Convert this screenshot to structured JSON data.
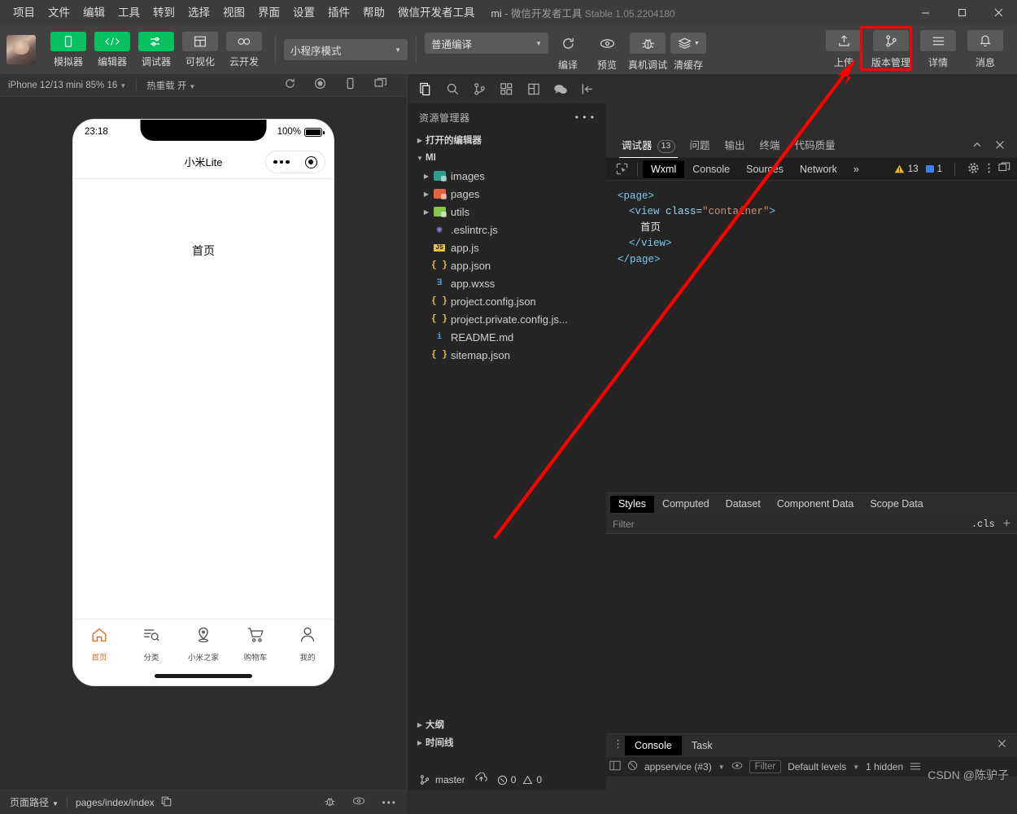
{
  "window": {
    "menus": [
      "项目",
      "文件",
      "编辑",
      "工具",
      "转到",
      "选择",
      "视图",
      "界面",
      "设置",
      "插件",
      "帮助",
      "微信开发者工具"
    ],
    "project_name": "mi",
    "dash": "-",
    "app_name": "微信开发者工具",
    "version": "Stable 1.05.2204180",
    "minimize": "−",
    "maximize": "□",
    "close": "✕"
  },
  "toolbar": {
    "left_buttons": [
      {
        "label": "模拟器",
        "icon": "phone-icon",
        "style": "green"
      },
      {
        "label": "编辑器",
        "icon": "code-icon",
        "style": "green"
      },
      {
        "label": "调试器",
        "icon": "sliders-icon",
        "style": "green"
      },
      {
        "label": "可视化",
        "icon": "layout-icon",
        "style": "grey"
      },
      {
        "label": "云开发",
        "icon": "cloud-icon",
        "style": "grey"
      }
    ],
    "mode_select": "小程序模式",
    "compile_select": "普通编译",
    "action_buttons": [
      {
        "label": "编译",
        "icon": "refresh-icon"
      },
      {
        "label": "预览",
        "icon": "eye-icon"
      },
      {
        "label": "真机调试",
        "icon": "bug-icon"
      },
      {
        "label": "清缓存",
        "icon": "layers-icon"
      }
    ],
    "right_buttons": [
      {
        "label": "上传",
        "icon": "upload-icon"
      },
      {
        "label": "版本管理",
        "icon": "git-branch-icon"
      },
      {
        "label": "详情",
        "icon": "menu-icon"
      },
      {
        "label": "消息",
        "icon": "bell-icon"
      }
    ],
    "highlighted_button": "版本管理"
  },
  "simulator": {
    "device": "iPhone 12/13 mini 85% 16",
    "hot_reload": "热重载 开",
    "icons": [
      "refresh-icon",
      "record-icon",
      "rotate-icon",
      "multi-window-icon"
    ],
    "phone": {
      "time": "23:18",
      "battery": "100%",
      "nav_title": "小米Lite",
      "page_text": "首页",
      "tabs": [
        {
          "label": "首页",
          "icon": "home-icon",
          "active": true
        },
        {
          "label": "分类",
          "icon": "category-icon",
          "active": false
        },
        {
          "label": "小米之家",
          "icon": "location-icon",
          "active": false
        },
        {
          "label": "购物车",
          "icon": "cart-icon",
          "active": false
        },
        {
          "label": "我的",
          "icon": "person-icon",
          "active": false
        }
      ]
    }
  },
  "explorer": {
    "activity_icons": [
      "files-icon",
      "search-icon",
      "source-control-icon",
      "extensions-icon",
      "snippets-icon",
      "wechat-icon",
      "collapse-icon"
    ],
    "title": "资源管理器",
    "more": "• • •",
    "sections": [
      {
        "label": "打开的编辑器",
        "expanded": false
      },
      {
        "label": "MI",
        "expanded": true
      }
    ],
    "files": [
      {
        "name": "images",
        "type": "folder",
        "color": "#2e9e8f"
      },
      {
        "name": "pages",
        "type": "folder",
        "color": "#e8603c"
      },
      {
        "name": "utils",
        "type": "folder",
        "color": "#8bc34a"
      },
      {
        "name": ".eslintrc.js",
        "type": "file",
        "icon": "eslint-icon",
        "glyph": "◉",
        "color": "#8a7fd1"
      },
      {
        "name": "app.js",
        "type": "file",
        "icon": "js-icon",
        "glyph": "JS",
        "color": "#e8c547"
      },
      {
        "name": "app.json",
        "type": "file",
        "icon": "json-icon",
        "glyph": "{ }",
        "color": "#e8c547"
      },
      {
        "name": "app.wxss",
        "type": "file",
        "icon": "css-icon",
        "glyph": "Ǝ",
        "color": "#4a9fe0"
      },
      {
        "name": "project.config.json",
        "type": "file",
        "icon": "json-icon",
        "glyph": "{ }",
        "color": "#e8c547"
      },
      {
        "name": "project.private.config.js...",
        "type": "file",
        "icon": "json-icon",
        "glyph": "{ }",
        "color": "#e8c547"
      },
      {
        "name": "README.md",
        "type": "file",
        "icon": "info-icon",
        "glyph": "i",
        "color": "#4a9fe0"
      },
      {
        "name": "sitemap.json",
        "type": "file",
        "icon": "json-icon",
        "glyph": "{ }",
        "color": "#e8c547"
      }
    ],
    "bottom_sections": [
      {
        "label": "大纲"
      },
      {
        "label": "时间线"
      }
    ],
    "git": {
      "branch": "master",
      "sync_icon": "sync-icon",
      "errors": "0",
      "warnings": "0"
    }
  },
  "devtools": {
    "panel_tabs": [
      {
        "label": "调试器",
        "badge": "13",
        "active": true
      },
      {
        "label": "问题",
        "badge": "",
        "active": false
      },
      {
        "label": "输出",
        "badge": "",
        "active": false
      },
      {
        "label": "终端",
        "badge": "",
        "active": false
      },
      {
        "label": "代码质量",
        "badge": "",
        "active": false
      }
    ],
    "panel_actions": [
      "chevron-up-icon",
      "close-icon"
    ],
    "inspector_tabs": [
      {
        "label": "Wxml",
        "active": true
      },
      {
        "label": "Console",
        "active": false
      },
      {
        "label": "Sources",
        "active": false
      },
      {
        "label": "Network",
        "active": false
      },
      {
        "label": "»",
        "active": false
      }
    ],
    "counters": {
      "warnings": "13",
      "messages": "1"
    },
    "wxml": [
      {
        "indent": 0,
        "parts": [
          {
            "t": "tag",
            "v": "<page>"
          }
        ]
      },
      {
        "indent": 1,
        "parts": [
          {
            "t": "tag",
            "v": "<view "
          },
          {
            "t": "attr",
            "v": "class="
          },
          {
            "t": "str",
            "v": "\"container\""
          },
          {
            "t": "tag",
            "v": ">"
          }
        ]
      },
      {
        "indent": 2,
        "parts": [
          {
            "t": "txt",
            "v": "首页"
          }
        ]
      },
      {
        "indent": 1,
        "parts": [
          {
            "t": "tag",
            "v": "</view>"
          }
        ]
      },
      {
        "indent": 0,
        "parts": [
          {
            "t": "tag",
            "v": "</page>"
          }
        ]
      }
    ],
    "styles_tabs": [
      {
        "label": "Styles",
        "active": true
      },
      {
        "label": "Computed",
        "active": false
      },
      {
        "label": "Dataset",
        "active": false
      },
      {
        "label": "Component Data",
        "active": false
      },
      {
        "label": "Scope Data",
        "active": false
      }
    ],
    "filter_placeholder": "Filter",
    "cls_button": ".cls",
    "add_button": "+",
    "console": {
      "tabs": [
        {
          "label": "Console",
          "active": true
        },
        {
          "label": "Task",
          "active": false
        }
      ],
      "context": "appservice (#3)",
      "filter_placeholder": "Filter",
      "levels": "Default levels",
      "hidden": "1 hidden",
      "close": "✕"
    },
    "watermark": "CSDN @陈驴子"
  },
  "statusbar": {
    "page_path_label": "页面路径",
    "page_path": "pages/index/index",
    "copy_icon": "copy-icon",
    "right_icons": [
      "bug-icon",
      "eye-icon",
      "more-icon"
    ]
  },
  "colors": {
    "accent_green": "#07c160",
    "highlight_red": "#ff0000",
    "tab_active_orange": "#ee6a24",
    "warning_yellow": "#e8c547"
  }
}
